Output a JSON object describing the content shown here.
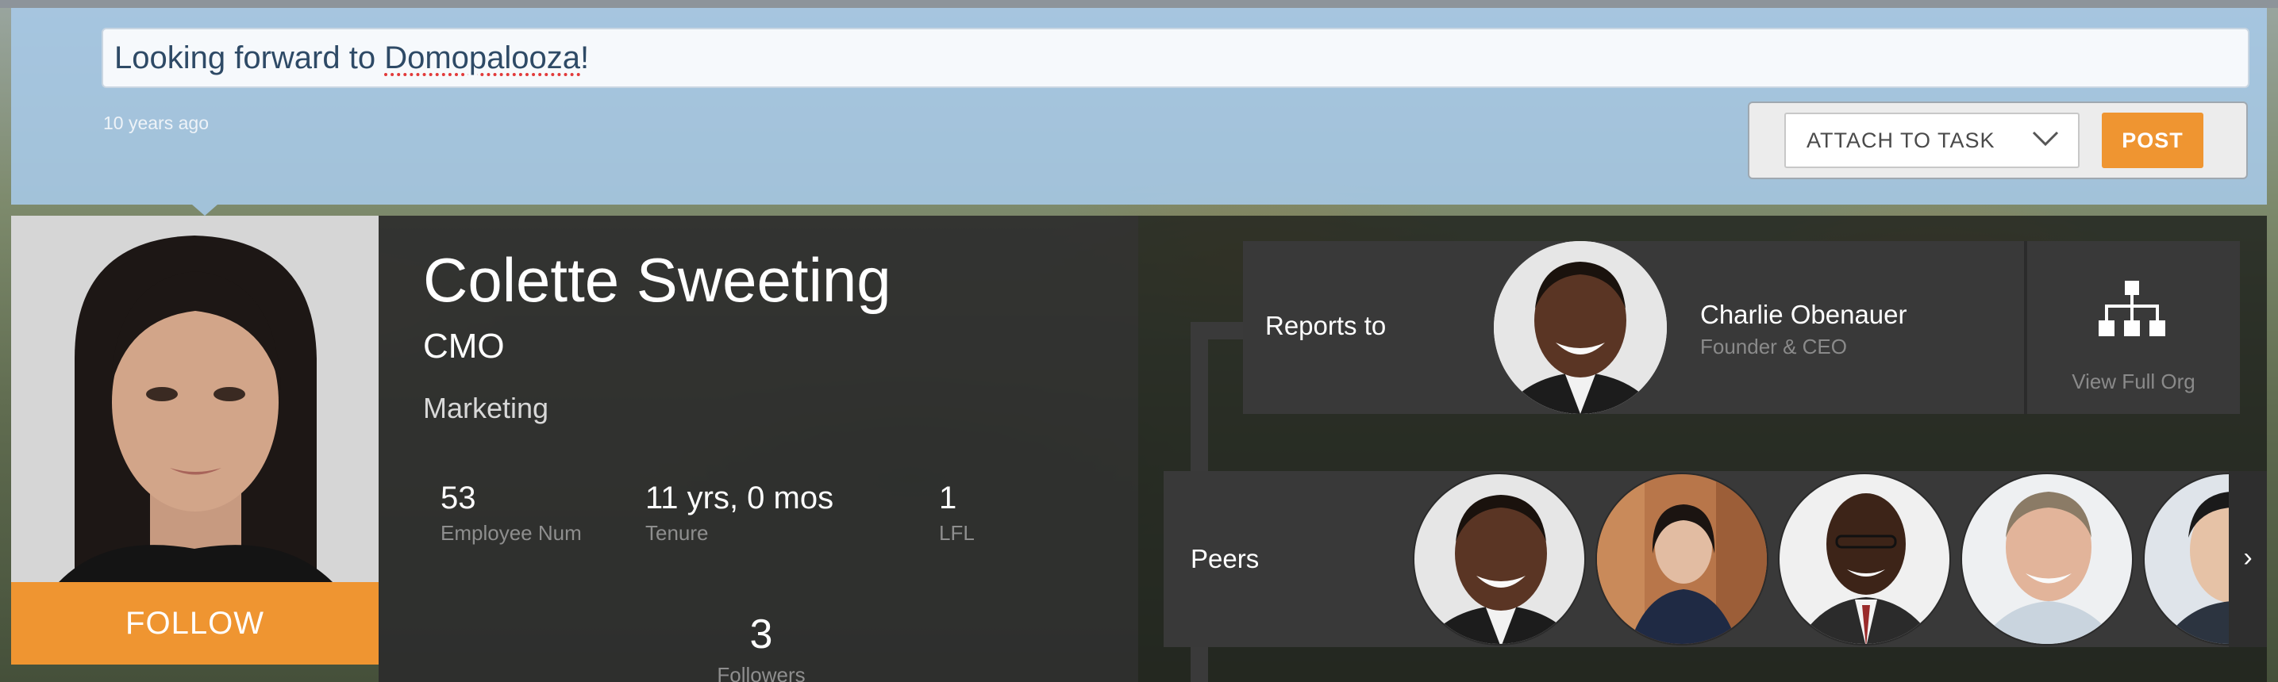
{
  "post": {
    "text_before": "Looking forward to ",
    "text_typo": "Domopalooza",
    "text_after": "!",
    "timestamp": "10 years ago",
    "attach_label": "ATTACH TO TASK",
    "post_label": "POST"
  },
  "profile": {
    "name": "Colette Sweeting",
    "title": "CMO",
    "department": "Marketing",
    "follow_label": "FOLLOW",
    "stats": [
      {
        "value": "53",
        "label": "Employee Num"
      },
      {
        "value": "11 yrs, 0 mos",
        "label": "Tenure"
      },
      {
        "value": "1",
        "label": "LFL"
      }
    ],
    "followers": {
      "value": "3",
      "label": "Followers"
    }
  },
  "org": {
    "reports_to_label": "Reports to",
    "manager": {
      "name": "Charlie Obenauer",
      "title": "Founder & CEO"
    },
    "view_full_org_label": "View Full Org",
    "peers_label": "Peers",
    "next_icon": "chevron-right-icon"
  },
  "colors": {
    "accent": "#ef9531",
    "composer_bg": "#a7c9e8",
    "panel_dark": "#2d2d2d",
    "box_dark": "#393939"
  }
}
